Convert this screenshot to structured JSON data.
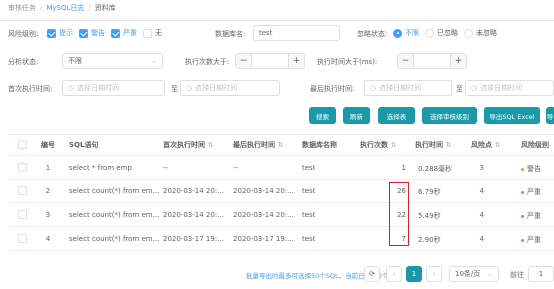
{
  "breadcrumb": {
    "items": [
      "审核任务",
      "MySQL日志",
      "资料库"
    ]
  },
  "filters": {
    "risk_label": "风险级别:",
    "risk_options": [
      {
        "label": "提示",
        "checked": true
      },
      {
        "label": "警告",
        "checked": true
      },
      {
        "label": "严重",
        "checked": true
      },
      {
        "label": "无",
        "checked": false
      }
    ],
    "db_label": "数据库名:",
    "db_value": "test",
    "ignore_label": "忽略状态:",
    "ignore_options": [
      {
        "label": "不限",
        "selected": true
      },
      {
        "label": "已忽略",
        "selected": false
      },
      {
        "label": "未忽略",
        "selected": false
      }
    ],
    "analysis_label": "分析状态:",
    "analysis_value": "不限",
    "exec_count_label": "执行次数大于:",
    "exec_time_label": "执行时间大于(ms):",
    "first_exec_label": "首次执行时间:",
    "last_exec_label": "最后执行时间:",
    "date_placeholder": "选择日期时间",
    "to": "至"
  },
  "actions": {
    "search": "搜索",
    "refresh": "刷新",
    "select_table": "选择表",
    "select_audit_level": "选择审核级别",
    "export_excel": "导出SQL Excel",
    "more": "导"
  },
  "table": {
    "headers": [
      "编号",
      "SQL语句",
      "首次执行时间",
      "最后执行时间",
      "数据库名称",
      "执行次数",
      "执行时间",
      "风险点",
      "风险级别"
    ],
    "rows": [
      {
        "id": "1",
        "sql": "select * from emp",
        "first": "--",
        "last": "--",
        "db": "test",
        "count": "1",
        "time": "0.288毫秒",
        "risk": "3",
        "level": "警告",
        "level_color": "#e6a23c"
      },
      {
        "id": "2",
        "sql": "select count(*) from em...",
        "first": "2020-03-14 20:...",
        "last": "2020-03-14 20:...",
        "db": "test",
        "count": "26",
        "time": "6.79秒",
        "risk": "4",
        "level": "严重",
        "level_color": "#f56c6c"
      },
      {
        "id": "3",
        "sql": "select count(*) from em...",
        "first": "2020-03-14 20:...",
        "last": "2020-03-14 20:...",
        "db": "test",
        "count": "22",
        "time": "5.49秒",
        "risk": "4",
        "level": "严重",
        "level_color": "#f56c6c"
      },
      {
        "id": "4",
        "sql": "select count(*) from em...",
        "first": "2020-03-17 19:...",
        "last": "2020-03-17 19:...",
        "db": "test",
        "count": "7",
        "time": "2.90秒",
        "risk": "4",
        "level": "严重",
        "level_color": "#f56c6c"
      }
    ]
  },
  "footer": {
    "note": "批量导出时最多可选择50个SQL，当前已选择0个",
    "page": "1",
    "page_size": "10条/页",
    "goto_label": "前往",
    "goto_value": "1"
  },
  "colors": {
    "primary": "#1a9aa8",
    "accent": "#409eff",
    "highlight": "#e02020"
  }
}
